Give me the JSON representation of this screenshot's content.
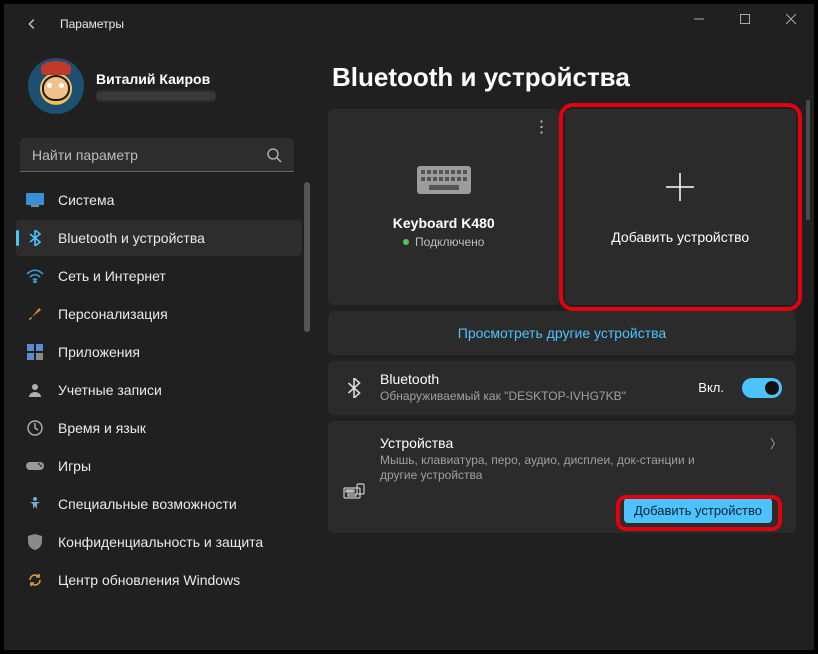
{
  "window": {
    "title": "Параметры"
  },
  "profile": {
    "name": "Виталий Каиров"
  },
  "search": {
    "placeholder": "Найти параметр"
  },
  "sidebar": {
    "items": [
      {
        "label": "Система"
      },
      {
        "label": "Bluetooth и устройства"
      },
      {
        "label": "Сеть и Интернет"
      },
      {
        "label": "Персонализация"
      },
      {
        "label": "Приложения"
      },
      {
        "label": "Учетные записи"
      },
      {
        "label": "Время и язык"
      },
      {
        "label": "Игры"
      },
      {
        "label": "Специальные возможности"
      },
      {
        "label": "Конфиденциальность и защита"
      },
      {
        "label": "Центр обновления Windows"
      }
    ]
  },
  "page": {
    "title": "Bluetooth и устройства",
    "device_tile": {
      "name": "Keyboard K480",
      "status": "Подключено"
    },
    "add_tile": {
      "label": "Добавить устройство"
    },
    "view_more": "Просмотреть другие устройства",
    "bluetooth_card": {
      "title": "Bluetooth",
      "subtitle": "Обнаруживаемый как \"DESKTOP-IVHG7KB\"",
      "status": "Вкл."
    },
    "devices_card": {
      "title": "Устройства",
      "subtitle": "Мышь, клавиатура, перо, аудио, дисплеи, док-станции и другие устройства",
      "button": "Добавить устройство"
    }
  }
}
